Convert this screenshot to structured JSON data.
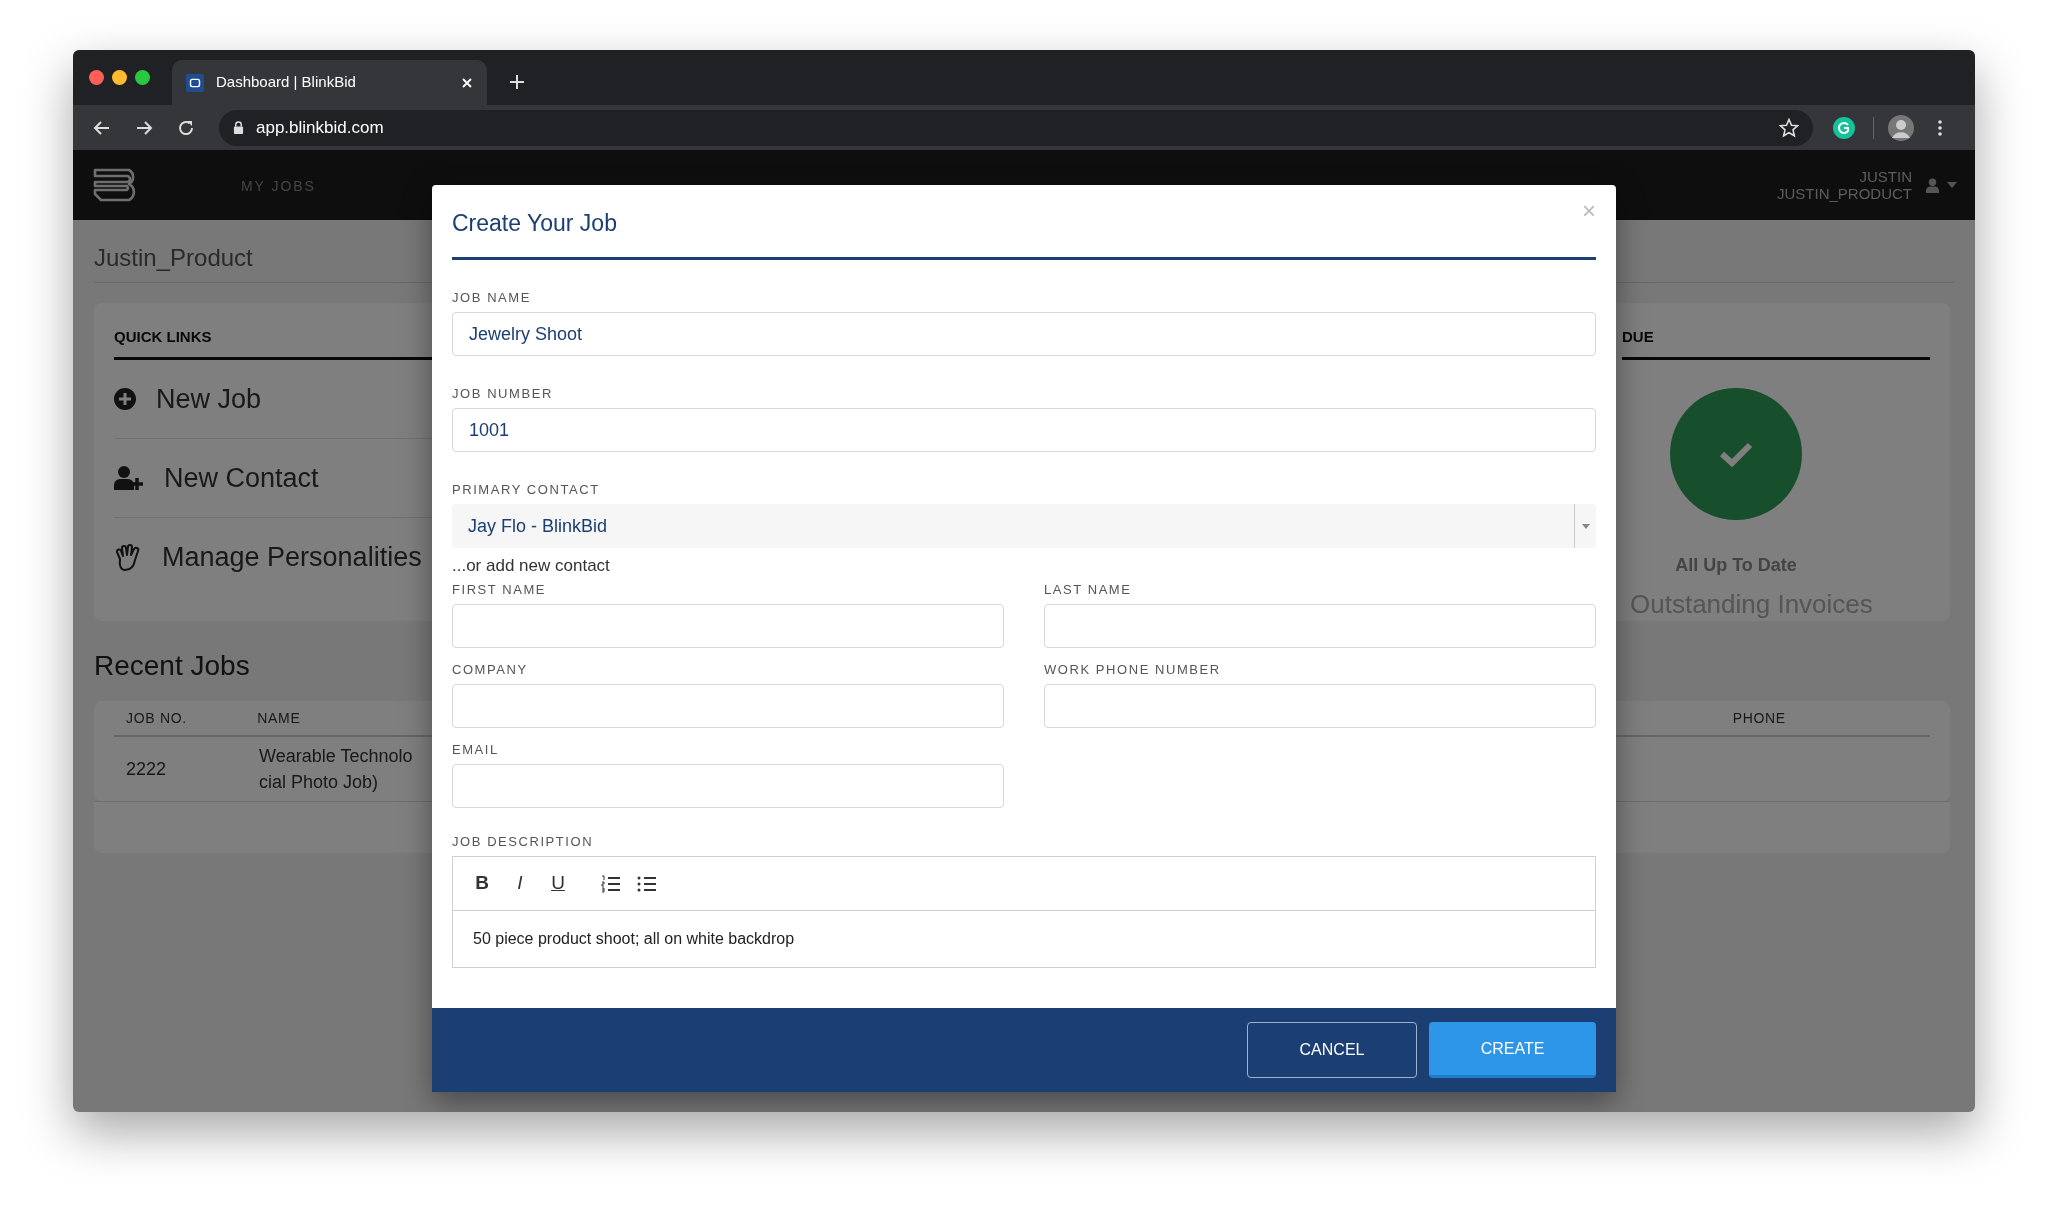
{
  "browser": {
    "tab_title": "Dashboard | BlinkBid",
    "url": "app.blinkbid.com"
  },
  "nav": {
    "items": [
      "MY JOBS"
    ],
    "user_name": "JUSTIN",
    "user_login": "JUSTIN_PRODUCT"
  },
  "page": {
    "title": "Justin_Product",
    "quick_links": {
      "heading": "QUICK LINKS",
      "items": [
        {
          "label": "New Job",
          "kind": "plus"
        },
        {
          "label": "New Contact",
          "kind": "person"
        },
        {
          "label": "Manage Personalities",
          "kind": "hand"
        }
      ]
    },
    "due_card": {
      "heading": "DUE",
      "status": "All Up To Date",
      "subtitle": "Outstanding Invoices"
    },
    "recent_jobs": {
      "title": "Recent Jobs",
      "columns": [
        "JOB NO.",
        "NAME",
        "PHONE"
      ],
      "rows": [
        {
          "job_no": "2222",
          "name_lines": [
            "Wearable Technolo",
            "cial Photo Job)"
          ]
        }
      ]
    }
  },
  "modal": {
    "title": "Create Your Job",
    "close": "×",
    "job_name": {
      "label": "JOB NAME",
      "value": "Jewelry Shoot"
    },
    "job_number": {
      "label": "JOB NUMBER",
      "value": "1001"
    },
    "primary_contact": {
      "label": "PRIMARY CONTACT",
      "value": "Jay Flo - BlinkBid"
    },
    "add_contact_hint": "...or add new contact",
    "contact_fields": [
      {
        "label": "FIRST NAME"
      },
      {
        "label": "LAST NAME"
      },
      {
        "label": "COMPANY"
      },
      {
        "label": "WORK PHONE NUMBER"
      },
      {
        "label": "EMAIL"
      }
    ],
    "description": {
      "label": "JOB DESCRIPTION",
      "toolbar": [
        {
          "kind": "bold",
          "text": "B"
        },
        {
          "kind": "italic",
          "text": "I"
        },
        {
          "kind": "underline",
          "text": "U"
        },
        {
          "kind": "ordered"
        },
        {
          "kind": "bullets"
        }
      ],
      "text": "50 piece product shoot; all on white backdrop"
    },
    "buttons": [
      "CANCEL",
      "CREATE"
    ]
  }
}
